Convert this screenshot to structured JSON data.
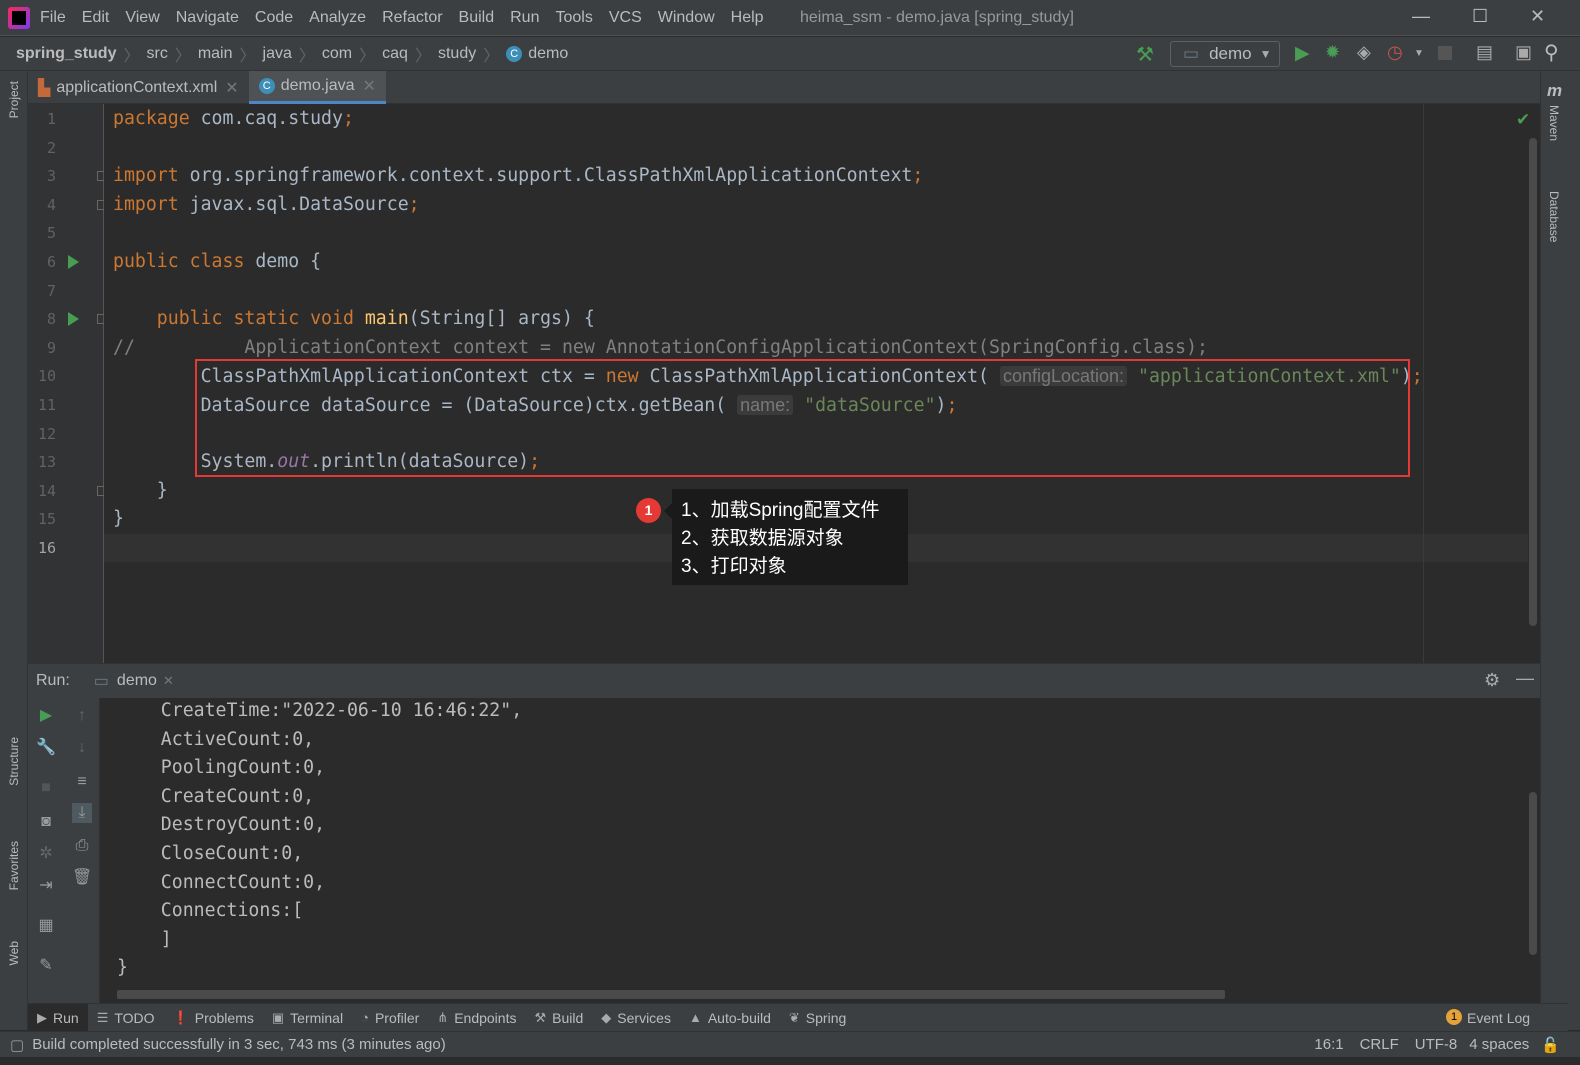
{
  "window": {
    "title": "heima_ssm - demo.java [spring_study]"
  },
  "menu": [
    "File",
    "Edit",
    "View",
    "Navigate",
    "Code",
    "Analyze",
    "Refactor",
    "Build",
    "Run",
    "Tools",
    "VCS",
    "Window",
    "Help"
  ],
  "breadcrumb": [
    "spring_study",
    "src",
    "main",
    "java",
    "com",
    "caq",
    "study",
    "demo"
  ],
  "run_config": "demo",
  "tabs": [
    {
      "label": "applicationContext.xml",
      "active": false
    },
    {
      "label": "demo.java",
      "active": true
    }
  ],
  "left_tools": [
    "Project",
    "Structure",
    "Favorites",
    "Web"
  ],
  "right_tools": [
    "Maven",
    "Database"
  ],
  "colors": {
    "keyword": "#cc7832",
    "string": "#6a8759",
    "method": "#ffc66d",
    "comment": "#808080",
    "field": "#9876aa",
    "text": "#a9b7c6",
    "annotation": "#e53935"
  },
  "code": [
    [
      {
        "t": "package ",
        "c": "keyword"
      },
      {
        "t": "com.caq.study",
        "c": "text"
      },
      {
        "t": ";",
        "c": "keyword"
      }
    ],
    [],
    [
      {
        "t": "import ",
        "c": "keyword"
      },
      {
        "t": "org.springframework.context.support.ClassPathXmlApplicationContext",
        "c": "text"
      },
      {
        "t": ";",
        "c": "keyword"
      }
    ],
    [
      {
        "t": "import ",
        "c": "keyword"
      },
      {
        "t": "javax.sql.DataSource",
        "c": "text"
      },
      {
        "t": ";",
        "c": "keyword"
      }
    ],
    [],
    [
      {
        "t": "public class ",
        "c": "keyword"
      },
      {
        "t": "demo {",
        "c": "text"
      }
    ],
    [],
    [
      {
        "t": "    public static void ",
        "c": "keyword"
      },
      {
        "t": "main",
        "c": "method"
      },
      {
        "t": "(String[] args) {",
        "c": "text"
      }
    ],
    [
      {
        "t": "//          ApplicationContext context = new AnnotationConfigApplicationContext(SpringConfig.class);",
        "c": "comment"
      }
    ],
    [
      {
        "t": "        ClassPathXmlApplicationContext ctx = ",
        "c": "text"
      },
      {
        "t": "new ",
        "c": "keyword"
      },
      {
        "t": "ClassPathXmlApplicationContext( ",
        "c": "text"
      },
      {
        "t": "configLocation:",
        "c": "hint"
      },
      {
        "t": " \"applicationContext.xml\"",
        "c": "string"
      },
      {
        "t": ")",
        "c": "text"
      },
      {
        "t": ";",
        "c": "keyword"
      }
    ],
    [
      {
        "t": "        DataSource dataSource = (DataSource)ctx.getBean( ",
        "c": "text"
      },
      {
        "t": "name:",
        "c": "hint"
      },
      {
        "t": " \"dataSource\"",
        "c": "string"
      },
      {
        "t": ")",
        "c": "text"
      },
      {
        "t": ";",
        "c": "keyword"
      }
    ],
    [],
    [
      {
        "t": "        System.",
        "c": "text"
      },
      {
        "t": "out",
        "c": "field"
      },
      {
        "t": ".println(dataSource)",
        "c": "text"
      },
      {
        "t": ";",
        "c": "keyword"
      }
    ],
    [
      {
        "t": "    }",
        "c": "text"
      }
    ],
    [
      {
        "t": "}",
        "c": "text"
      }
    ],
    []
  ],
  "annotation": {
    "number": "1",
    "lines": [
      "1、加载Spring配置文件",
      "2、获取数据源对象",
      "3、打印对象"
    ]
  },
  "run": {
    "label": "Run:",
    "tab": "demo"
  },
  "console": [
    "    CreateTime:\"2022-06-10 16:46:22\",",
    "    ActiveCount:0,",
    "    PoolingCount:0,",
    "    CreateCount:0,",
    "    DestroyCount:0,",
    "    CloseCount:0,",
    "    ConnectCount:0,",
    "    Connections:[",
    "    ]",
    "}"
  ],
  "tool_windows": [
    {
      "label": "Run",
      "icon": "play"
    },
    {
      "label": "TODO",
      "icon": "list"
    },
    {
      "label": "Problems",
      "icon": "alert"
    },
    {
      "label": "Terminal",
      "icon": "terminal"
    },
    {
      "label": "Profiler",
      "icon": "profiler"
    },
    {
      "label": "Endpoints",
      "icon": "endpoints"
    },
    {
      "label": "Build",
      "icon": "hammer"
    },
    {
      "label": "Services",
      "icon": "services"
    },
    {
      "label": "Auto-build",
      "icon": "warning"
    },
    {
      "label": "Spring",
      "icon": "leaf"
    }
  ],
  "event_log": {
    "label": "Event Log",
    "count": "1"
  },
  "status": {
    "message": "Build completed successfully in 3 sec, 743 ms (3 minutes ago)",
    "position": "16:1",
    "line_sep": "CRLF",
    "encoding": "UTF-8",
    "indent": "4 spaces"
  }
}
